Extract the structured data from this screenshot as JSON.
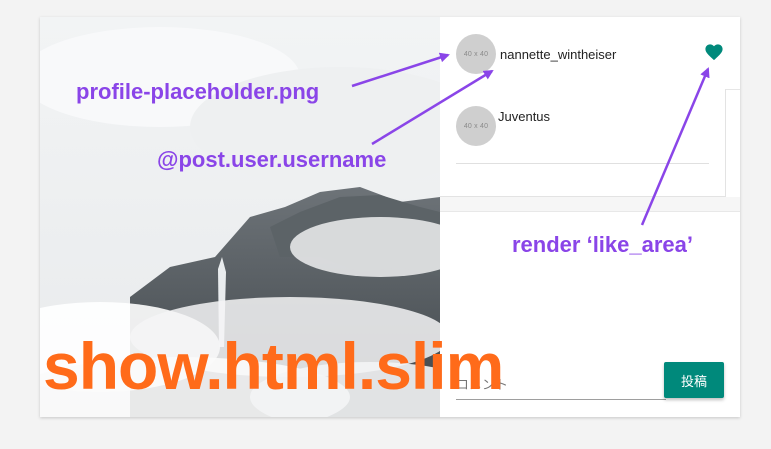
{
  "post": {
    "username": "nannette_wintheiser",
    "avatar_placeholder": "40 x 40",
    "like_icon": "heart-icon",
    "like_color": "#00897b"
  },
  "comments": [
    {
      "username": "Juventus",
      "avatar_placeholder": "40 x 40"
    }
  ],
  "comment_form": {
    "placeholder": "コメント",
    "submit_label": "投稿",
    "submit_color": "#00897b"
  },
  "annotations": {
    "avatar_note": "profile-placeholder.png",
    "username_note": "@post.user.username",
    "like_note": "render ‘like_area’",
    "file_title": "show.html.slim",
    "annotation_color": "#8a45e8",
    "title_color": "#ff6b1a"
  }
}
